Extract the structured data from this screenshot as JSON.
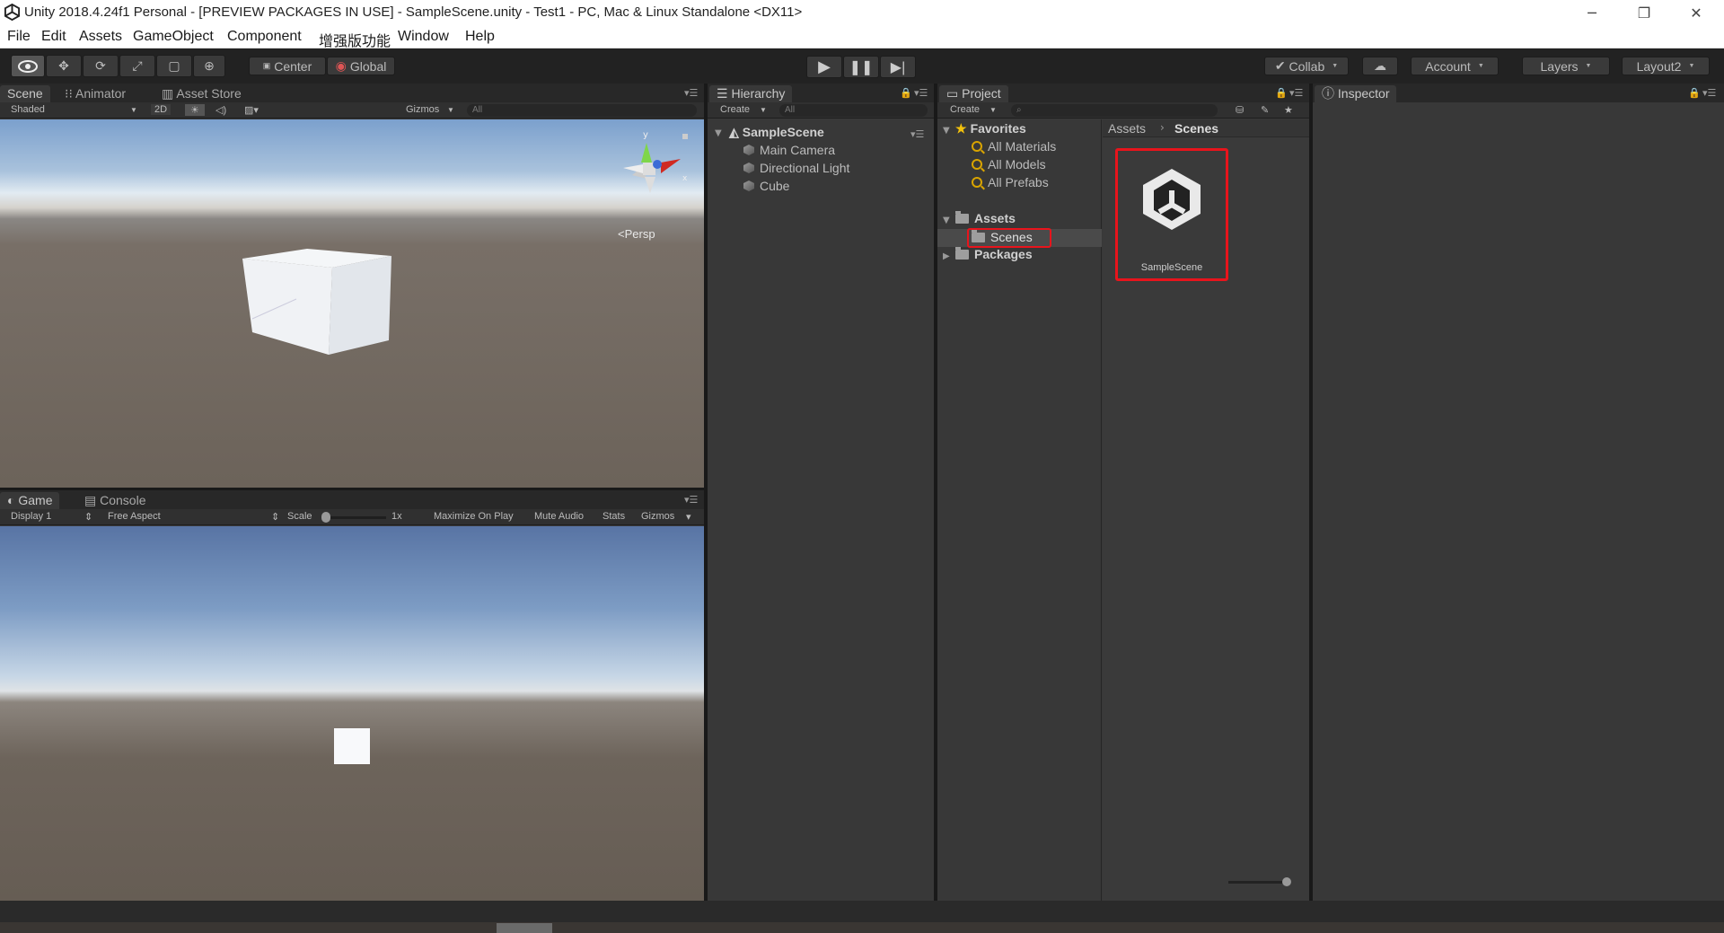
{
  "window": {
    "title": "Unity 2018.4.24f1 Personal - [PREVIEW PACKAGES IN USE] - SampleScene.unity - Test1 - PC, Mac & Linux Standalone <DX11>",
    "minimize": "─",
    "restore": "❐",
    "close": "✕"
  },
  "menu": [
    "File",
    "Edit",
    "Assets",
    "GameObject",
    "Component",
    "增强版功能",
    "Window",
    "Help"
  ],
  "toolbar": {
    "pivot": "Center",
    "space": "Global",
    "collab": "Collab",
    "account": "Account",
    "layers": "Layers",
    "layout": "Layout2"
  },
  "scene_panel": {
    "tabs": [
      "Scene",
      "Animator",
      "Asset Store"
    ],
    "shading": "Shaded",
    "mode_2d": "2D",
    "gizmos": "Gizmos",
    "search_placeholder": "All",
    "persp_label": "Persp",
    "gizmo_y": "y",
    "gizmo_x": "x"
  },
  "game_panel": {
    "tabs": [
      "Game",
      "Console"
    ],
    "display": "Display 1",
    "aspect": "Free Aspect",
    "scale_label": "Scale",
    "scale_value": "1x",
    "maximize": "Maximize On Play",
    "mute": "Mute Audio",
    "stats": "Stats",
    "gizmos": "Gizmos"
  },
  "hierarchy": {
    "tab": "Hierarchy",
    "create": "Create",
    "search_placeholder": "All",
    "scene": "SampleScene",
    "items": [
      "Main Camera",
      "Directional Light",
      "Cube"
    ]
  },
  "project": {
    "tab": "Project",
    "create": "Create",
    "favorites_label": "Favorites",
    "favorites": [
      "All Materials",
      "All Models",
      "All Prefabs"
    ],
    "assets_label": "Assets",
    "assets_children": [
      "Scenes"
    ],
    "packages_label": "Packages",
    "breadcrumb": [
      "Assets",
      "Scenes"
    ],
    "asset_tile": "SampleScene"
  },
  "inspector": {
    "tab": "Inspector"
  },
  "colors": {
    "highlight": "#e8141c",
    "selected_row": "#4a4a4a"
  }
}
